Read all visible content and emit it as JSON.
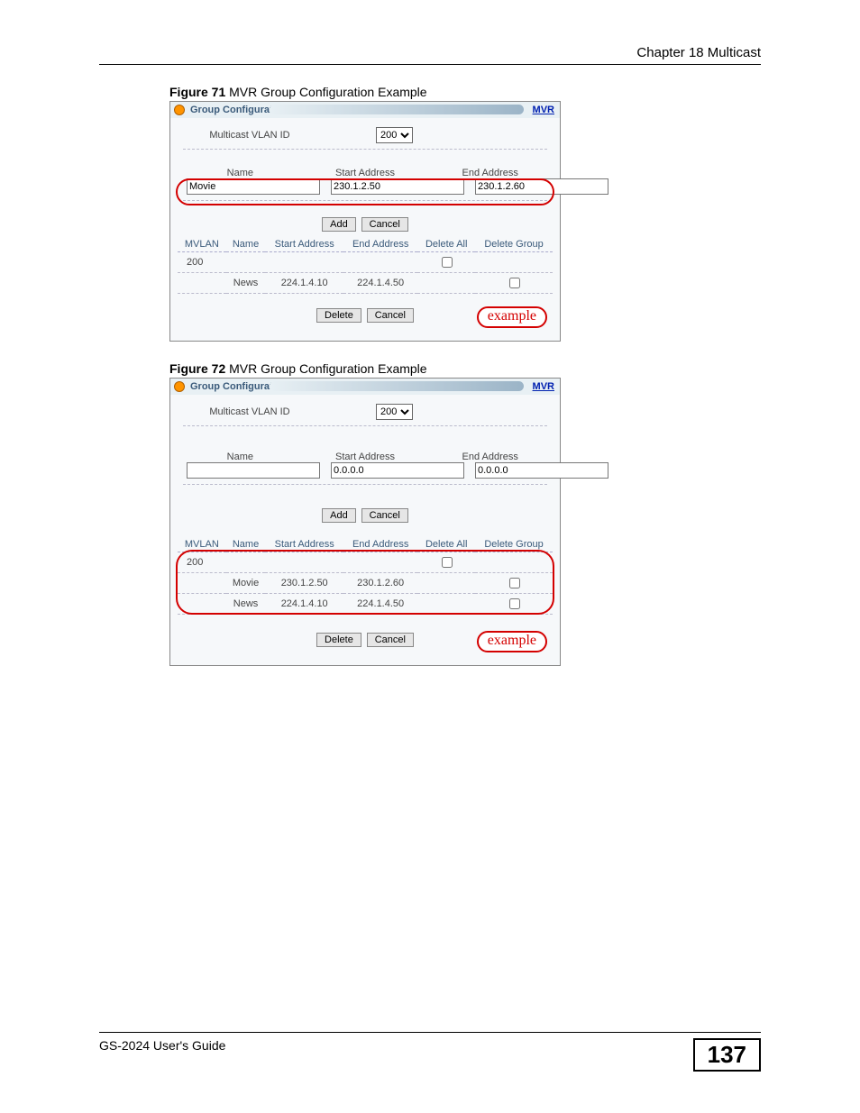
{
  "header": {
    "chapter": "Chapter 18 Multicast"
  },
  "footer": {
    "guide": "GS-2024 User's Guide",
    "page": "137"
  },
  "fig71": {
    "caption_bold": "Figure 71",
    "caption_rest": "   MVR Group Configuration Example",
    "panel_title": "Group Configuration",
    "mvr_link": "MVR",
    "mvid_label": "Multicast VLAN ID",
    "mvid_value": "200",
    "col_name": "Name",
    "col_start": "Start Address",
    "col_end": "End Address",
    "inp_name": "Movie",
    "inp_start": "230.1.2.50",
    "inp_end": "230.1.2.60",
    "btn_add": "Add",
    "btn_cancel": "Cancel",
    "th_mvlan": "MVLAN",
    "th_name": "Name",
    "th_start": "Start Address",
    "th_end": "End Address",
    "th_delall": "Delete All",
    "th_delgrp": "Delete Group",
    "row_mvlan": "200",
    "row2_name": "News",
    "row2_start": "224.1.4.10",
    "row2_end": "224.1.4.50",
    "btn_delete": "Delete",
    "btn_cancel2": "Cancel",
    "example": "example"
  },
  "fig72": {
    "caption_bold": "Figure 72",
    "caption_rest": "   MVR Group Configuration Example",
    "panel_title": "Group Configuration",
    "mvr_link": "MVR",
    "mvid_label": "Multicast VLAN ID",
    "mvid_value": "200",
    "col_name": "Name",
    "col_start": "Start Address",
    "col_end": "End Address",
    "inp_name": "",
    "inp_start": "0.0.0.0",
    "inp_end": "0.0.0.0",
    "btn_add": "Add",
    "btn_cancel": "Cancel",
    "th_mvlan": "MVLAN",
    "th_name": "Name",
    "th_start": "Start Address",
    "th_end": "End Address",
    "th_delall": "Delete All",
    "th_delgrp": "Delete Group",
    "row_mvlan": "200",
    "row2_name": "Movie",
    "row2_start": "230.1.2.50",
    "row2_end": "230.1.2.60",
    "row3_name": "News",
    "row3_start": "224.1.4.10",
    "row3_end": "224.1.4.50",
    "btn_delete": "Delete",
    "btn_cancel2": "Cancel",
    "example": "example"
  }
}
